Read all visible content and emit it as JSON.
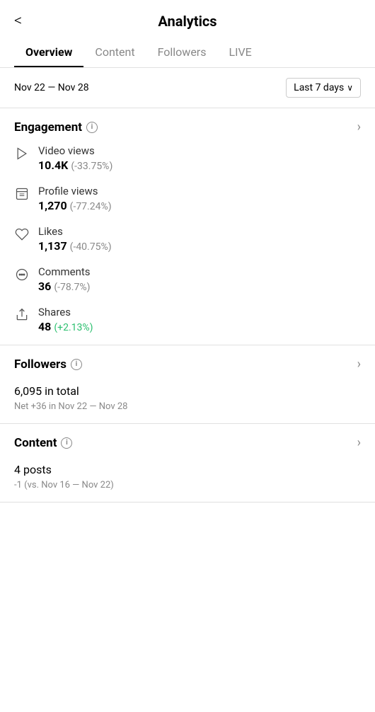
{
  "header": {
    "back_label": "<",
    "title": "Analytics"
  },
  "tabs": [
    {
      "label": "Overview",
      "active": true
    },
    {
      "label": "Content",
      "active": false
    },
    {
      "label": "Followers",
      "active": false
    },
    {
      "label": "LIVE",
      "active": false
    }
  ],
  "date_range": {
    "label": "Nov 22 — Nov 28",
    "dropdown_label": "Last 7 days",
    "dropdown_arrow": "∨"
  },
  "engagement": {
    "section_title": "Engagement",
    "info_icon": "i",
    "chevron": "›",
    "metrics": [
      {
        "id": "video-views",
        "label": "Video views",
        "value": "10.4K",
        "change": "(-33.75%)",
        "positive": false
      },
      {
        "id": "profile-views",
        "label": "Profile views",
        "value": "1,270",
        "change": "(-77.24%)",
        "positive": false
      },
      {
        "id": "likes",
        "label": "Likes",
        "value": "1,137",
        "change": "(-40.75%)",
        "positive": false
      },
      {
        "id": "comments",
        "label": "Comments",
        "value": "36",
        "change": "(-78.7%)",
        "positive": false
      },
      {
        "id": "shares",
        "label": "Shares",
        "value": "48",
        "change": "(+2.13%)",
        "positive": true
      }
    ]
  },
  "followers": {
    "section_title": "Followers",
    "info_icon": "i",
    "chevron": "›",
    "total": "6,095",
    "total_suffix": " in total",
    "net": "Net +36 in Nov 22 — Nov 28"
  },
  "content": {
    "section_title": "Content",
    "info_icon": "i",
    "chevron": "›",
    "posts": "4",
    "posts_suffix": " posts",
    "vs": "-1 (vs. Nov 16 — Nov 22)"
  }
}
